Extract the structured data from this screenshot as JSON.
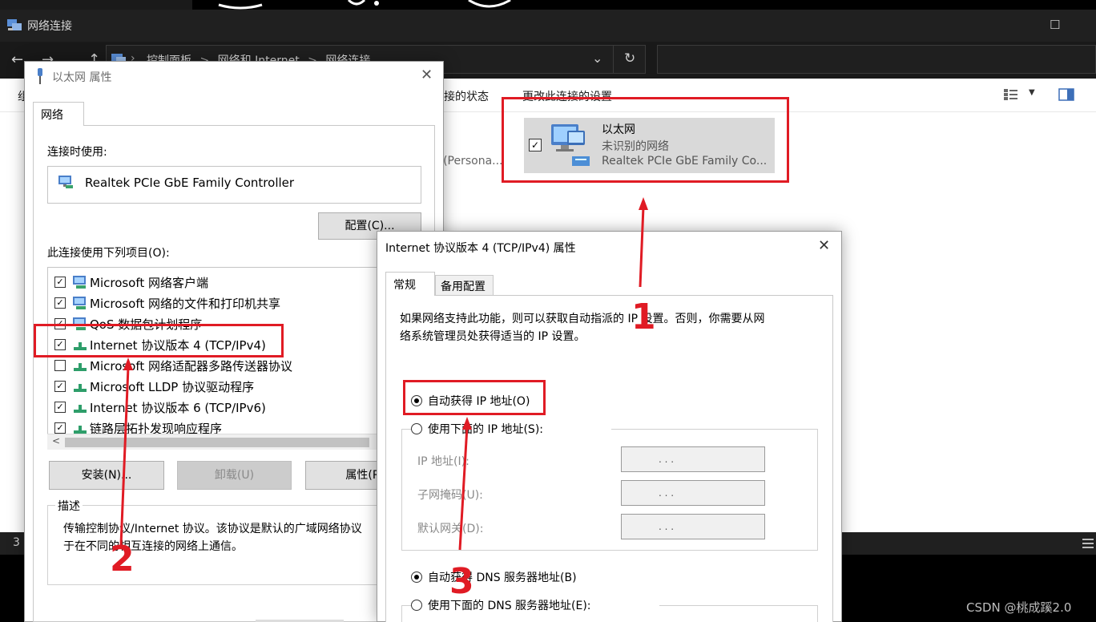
{
  "explorer": {
    "title": "网络连接",
    "breadcrumb": [
      "控制面板",
      "网络和 Internet",
      "网络连接"
    ],
    "breadcrumb_sep": ">",
    "toolbar_left": "组",
    "toolbar_status": "接的状态",
    "toolbar_change": "更改此连接的设置",
    "partial_text": "e (Persona...",
    "status_count": "3",
    "ethernet": {
      "name": "以太网",
      "status": "未识别的网络",
      "device": "Realtek PCIe GbE Family Co..."
    }
  },
  "eth_dialog": {
    "title": "以太网 属性",
    "tab": "网络",
    "connect_using": "连接时使用:",
    "adapter": "Realtek PCIe GbE Family Controller",
    "configure": "配置(C)...",
    "items_label": "此连接使用下列项目(O):",
    "items": [
      {
        "label": "Microsoft 网络客户端",
        "checked": true
      },
      {
        "label": "Microsoft 网络的文件和打印机共享",
        "checked": true
      },
      {
        "label": "QoS 数据包计划程序",
        "checked": true
      },
      {
        "label": "Internet 协议版本 4 (TCP/IPv4)",
        "checked": true
      },
      {
        "label": "Microsoft 网络适配器多路传送器协议",
        "checked": false
      },
      {
        "label": "Microsoft LLDP 协议驱动程序",
        "checked": true
      },
      {
        "label": "Internet 协议版本 6 (TCP/IPv6)",
        "checked": true
      },
      {
        "label": "链路层拓扑发现响应程序",
        "checked": true
      }
    ],
    "install": "安装(N)...",
    "uninstall": "卸载(U)",
    "properties": "属性(R",
    "description_label": "描述",
    "description": "传输控制协议/Internet 协议。该协议是默认的广域网络协议，它提供了在不同的相互连接的网络上通信。",
    "description_line1": "传输控制协议/Internet 协议。该协议是默认的广域网络协议",
    "description_line2": "于在不同的相互连接的网络上通信。"
  },
  "ipv4_dialog": {
    "title": "Internet 协议版本 4 (TCP/IPv4) 属性",
    "tab_general": "常规",
    "tab_alternate": "备用配置",
    "info_line1": "如果网络支持此功能，则可以获取自动指派的 IP 设置。否则，你需要从网",
    "info_line2": "络系统管理员处获得适当的 IP 设置。",
    "auto_ip": "自动获得 IP 地址(O)",
    "manual_ip": "使用下面的 IP 地址(S):",
    "ip_address": "IP 地址(I):",
    "subnet_mask": "子网掩码(U):",
    "gateway": "默认网关(D):",
    "ip_placeholder": ".       .       .",
    "auto_dns": "自动获得 DNS 服务器地址(B)",
    "manual_dns": "使用下面的 DNS 服务器地址(E):"
  },
  "annotations": {
    "step1": "1",
    "step2": "2",
    "step3": "3",
    "color": "#e01b24"
  },
  "watermark": "CSDN @桃成蹊2.0"
}
